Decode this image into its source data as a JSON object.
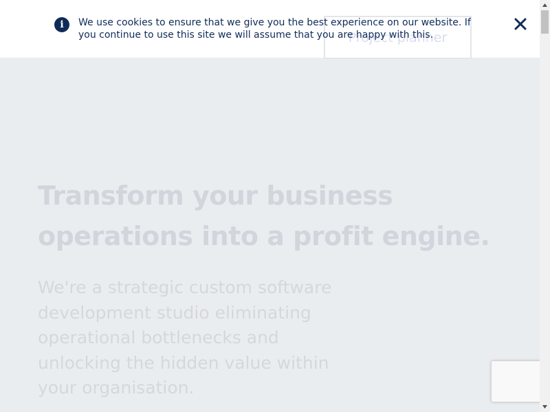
{
  "header": {
    "planner_button_label": "Project planner"
  },
  "cookie_banner": {
    "icon": "info-icon",
    "text": "We use cookies to ensure that we give you the best experience on our website. If you continue to use this site we will assume that you are happy with this.",
    "close_icon": "close-icon"
  },
  "hero": {
    "title": "Transform your business operations into a profit engine.",
    "subtitle": "We're a strategic custom software development studio eliminating operational bottlenecks and unlocking the hidden value within your organisation."
  },
  "colors": {
    "background": "#eaedf0",
    "banner_text": "#0f2b58",
    "faded_text": "#d2d5dc"
  }
}
